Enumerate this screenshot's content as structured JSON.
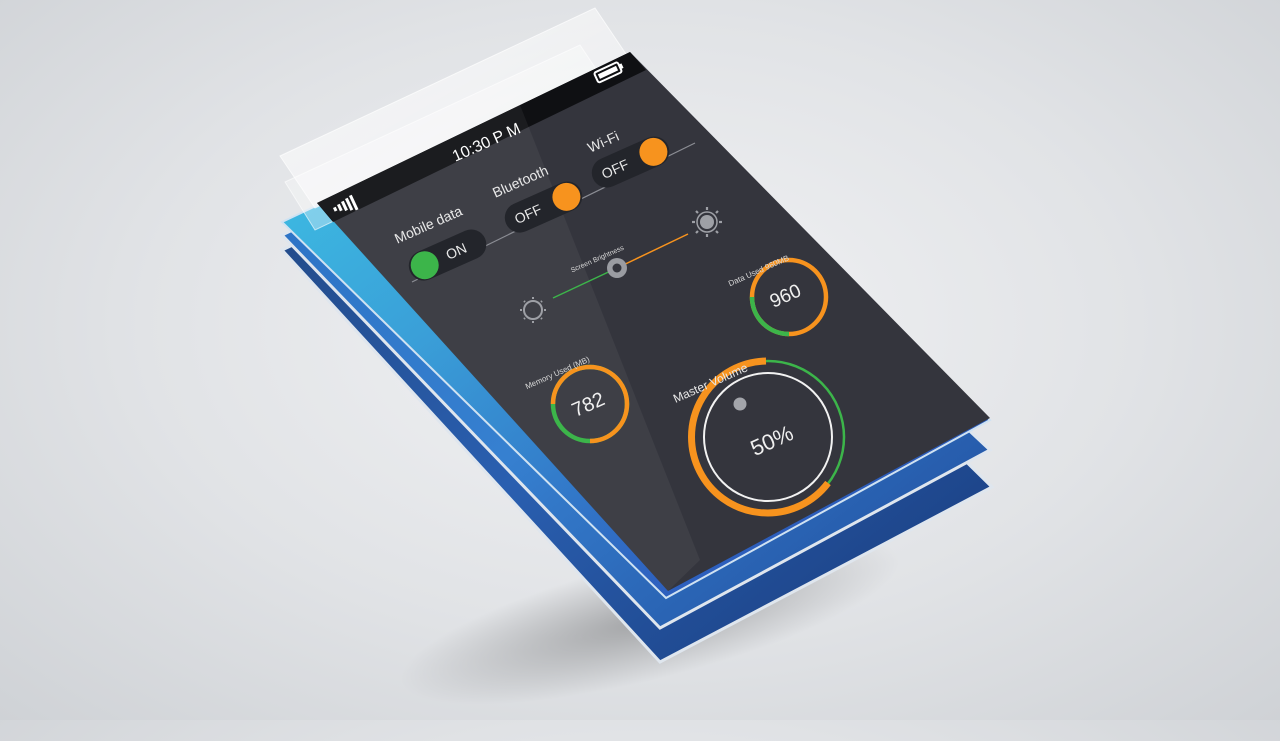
{
  "status_bar": {
    "time": "10:30 P M"
  },
  "toggles": {
    "mobile_data": {
      "label": "Mobile data",
      "state": "ON",
      "on": true
    },
    "bluetooth": {
      "label": "Bluetooth",
      "state": "OFF",
      "on": false
    },
    "wifi": {
      "label": "Wi-Fi",
      "state": "OFF",
      "on": false
    }
  },
  "brightness": {
    "label": "Screen Brightness",
    "level": 0.5
  },
  "data_used": {
    "label": "Data Used 960MB",
    "value": "960",
    "fraction": 0.25
  },
  "memory_used": {
    "label": "Memory Used (MB)",
    "value": "782",
    "fraction": 0.5
  },
  "master_volume": {
    "label": "Master Volume",
    "value": "50%",
    "fraction": 0.5
  },
  "colors": {
    "accent_orange": "#f7931e",
    "accent_green": "#3cb54a",
    "screen_bg": "#34353d",
    "status_bar": "#101114",
    "layer_blue_light": "#3aa7d8",
    "layer_blue_dark": "#1c3f8f"
  },
  "icons": [
    "signal-icon",
    "battery-icon",
    "sun-small-icon",
    "sun-large-icon"
  ]
}
